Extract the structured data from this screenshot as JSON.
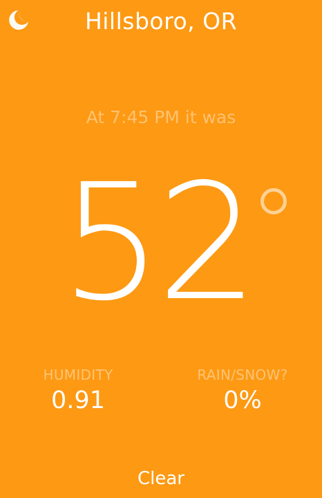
{
  "header": {
    "city": "Hillsboro, OR",
    "theme_toggle_icon": "moon-icon"
  },
  "reading": {
    "time_text": "At 7:45 PM it was",
    "temperature": "52",
    "degree_icon": "degree-icon"
  },
  "stats": {
    "humidity": {
      "label": "HUMIDITY",
      "value": "0.91"
    },
    "rain": {
      "label": "RAIN/SNOW?",
      "value": "0%"
    }
  },
  "condition": "Clear",
  "colors": {
    "background": "#FD9913",
    "text": "#FFFFFF"
  }
}
